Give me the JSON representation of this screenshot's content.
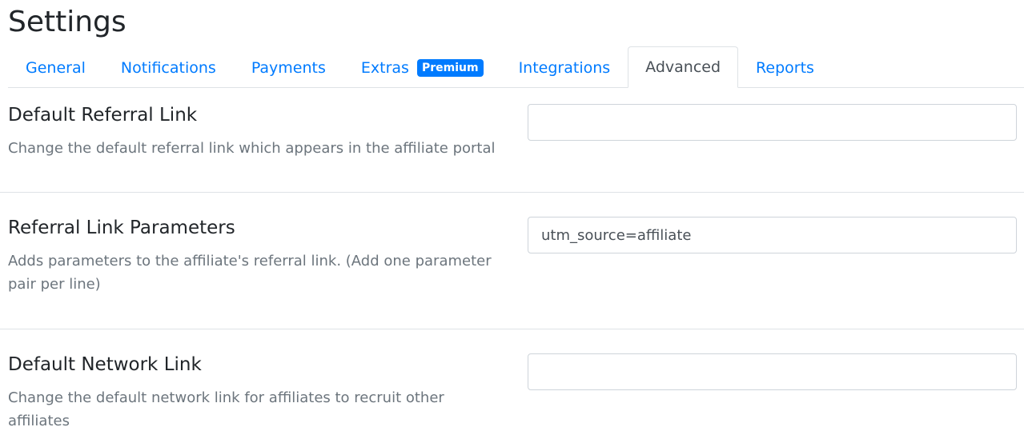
{
  "page": {
    "title": "Settings"
  },
  "tabs": [
    {
      "label": "General",
      "active": false
    },
    {
      "label": "Notifications",
      "active": false
    },
    {
      "label": "Payments",
      "active": false
    },
    {
      "label": "Extras",
      "active": false,
      "badge": "Premium"
    },
    {
      "label": "Integrations",
      "active": false
    },
    {
      "label": "Advanced",
      "active": true
    },
    {
      "label": "Reports",
      "active": false
    }
  ],
  "settings": {
    "default_referral_link": {
      "heading": "Default Referral Link",
      "description": "Change the default referral link which appears in the affiliate portal",
      "value": ""
    },
    "referral_link_parameters": {
      "heading": "Referral Link Parameters",
      "description": "Adds parameters to the affiliate's referral link. (Add one parameter pair per line)",
      "value": "utm_source=affiliate"
    },
    "default_network_link": {
      "heading": "Default Network Link",
      "description": "Change the default network link for affiliates to recruit other affiliates",
      "value": ""
    }
  },
  "colors": {
    "link": "#007bff",
    "badge_bg": "#007bff",
    "active_tab_text": "#495057",
    "muted_text": "#6c757d",
    "border": "#dee2e6"
  }
}
